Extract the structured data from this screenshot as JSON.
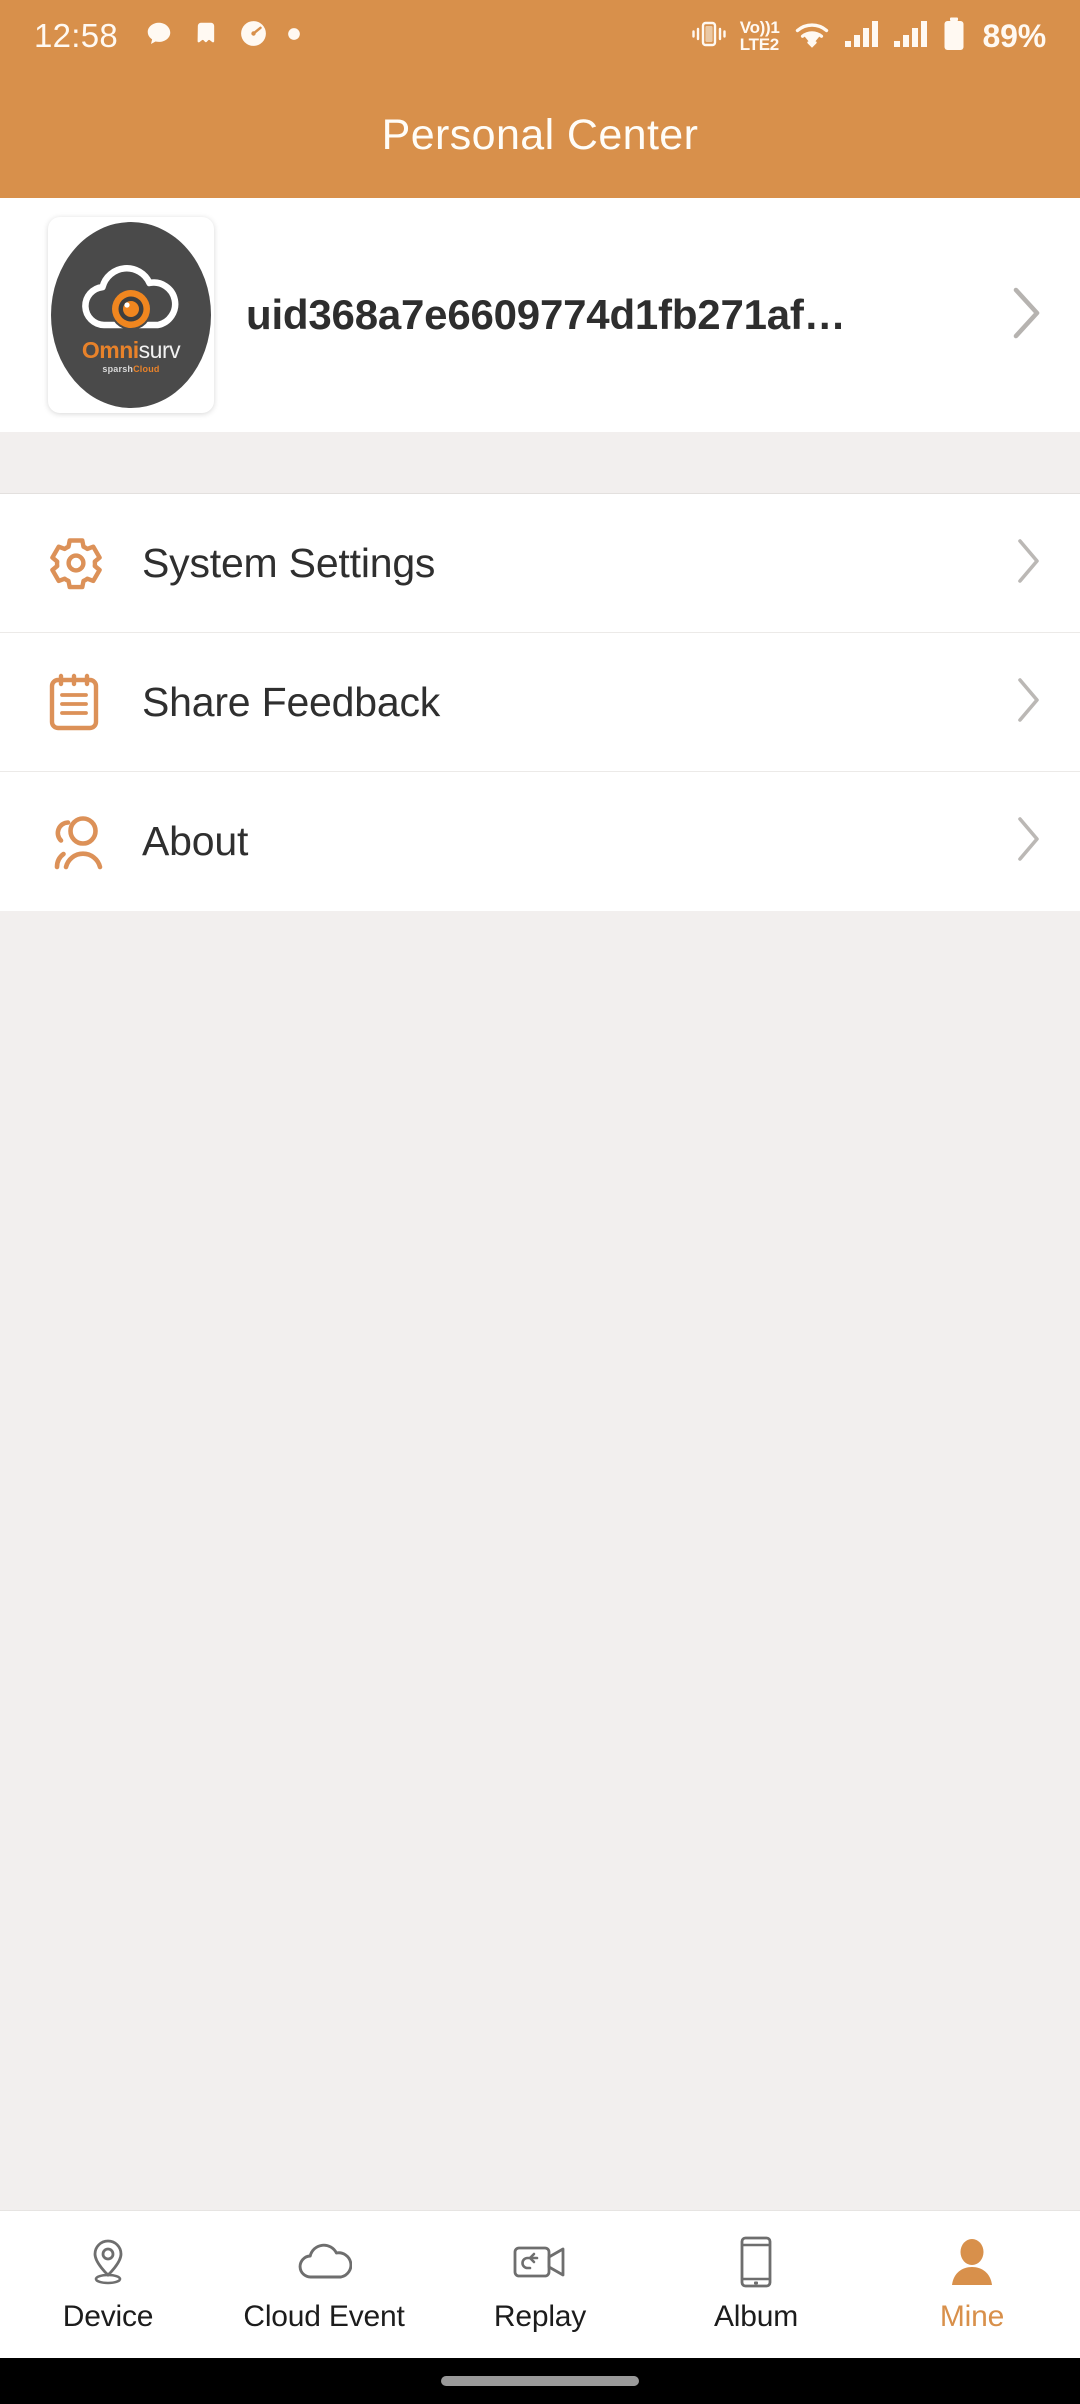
{
  "theme": {
    "accent": "#D8904B",
    "accent_logo": "#E8822A",
    "header_text": "#FFFDF8",
    "page_bg": "#F2EFEE",
    "card_bg": "#FFFFFF",
    "text_primary": "#2F2F2F",
    "nav_inactive": "#6E6E6E",
    "chevron": "#B6B3B0"
  },
  "status_bar": {
    "time": "12:58",
    "left_icons": [
      "chat-bubble-icon",
      "app-notification-icon",
      "speedometer-icon",
      "dot-icon"
    ],
    "right_icons": [
      "vibrate-icon",
      "volte-icon",
      "wifi-icon",
      "signal-sim1-icon",
      "signal-sim2-icon",
      "battery-icon"
    ],
    "volte_line1": "Vo))1",
    "volte_line2": "LTE2",
    "battery_percent": "89%"
  },
  "header": {
    "title": "Personal Center"
  },
  "profile": {
    "avatar_icon": "omnisurv-logo-avatar",
    "logo_word_1": "Omni",
    "logo_word_2": "surv",
    "logo_sub_1": "sparsh",
    "logo_sub_2": "Cloud",
    "uid": "uid368a7e6609774d1fb271af…",
    "chevron_icon": "chevron-right-icon"
  },
  "menu": {
    "items": [
      {
        "label": "System Settings",
        "icon": "gear-icon",
        "chevron": "chevron-right-icon"
      },
      {
        "label": "Share Feedback",
        "icon": "clipboard-icon",
        "chevron": "chevron-right-icon"
      },
      {
        "label": "About",
        "icon": "people-icon",
        "chevron": "chevron-right-icon"
      }
    ]
  },
  "bottom_nav": {
    "items": [
      {
        "label": "Device",
        "icon": "location-pin-icon",
        "active": false
      },
      {
        "label": "Cloud Event",
        "icon": "cloud-icon",
        "active": false
      },
      {
        "label": "Replay",
        "icon": "replay-video-icon",
        "active": false
      },
      {
        "label": "Album",
        "icon": "tablet-icon",
        "active": false
      },
      {
        "label": "Mine",
        "icon": "person-icon",
        "active": true
      }
    ]
  },
  "gesture_bar": {
    "handle": "home-indicator"
  }
}
